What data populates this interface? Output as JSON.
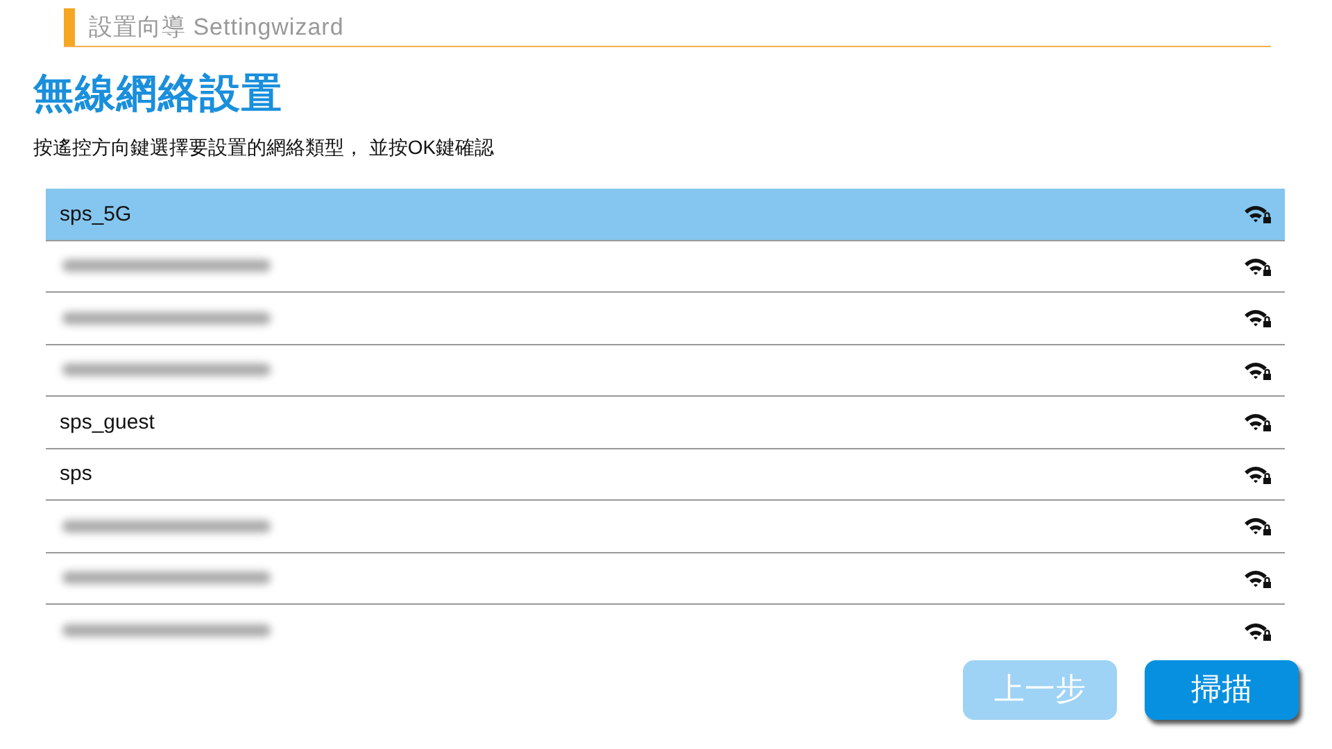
{
  "header": {
    "title": "設置向導 Settingwizard"
  },
  "page_title": "無線網絡設置",
  "instruction": "按遙控方向鍵選擇要設置的網絡類型， 並按OK鍵確認",
  "networks": [
    {
      "kind": "named",
      "name": "sps_5G",
      "selected": true,
      "secured": true
    },
    {
      "kind": "redacted",
      "selected": false,
      "secured": true
    },
    {
      "kind": "redacted",
      "selected": false,
      "secured": true
    },
    {
      "kind": "redacted",
      "selected": false,
      "secured": true
    },
    {
      "kind": "named",
      "name": "sps_guest",
      "selected": false,
      "secured": true
    },
    {
      "kind": "named",
      "name": "sps",
      "selected": false,
      "secured": true
    },
    {
      "kind": "redacted",
      "selected": false,
      "secured": true
    },
    {
      "kind": "redacted",
      "selected": false,
      "secured": true
    },
    {
      "kind": "redacted",
      "selected": false,
      "secured": true
    }
  ],
  "buttons": [
    {
      "label": "上一步",
      "disabled": true
    },
    {
      "label": "掃描",
      "disabled": false
    }
  ]
}
